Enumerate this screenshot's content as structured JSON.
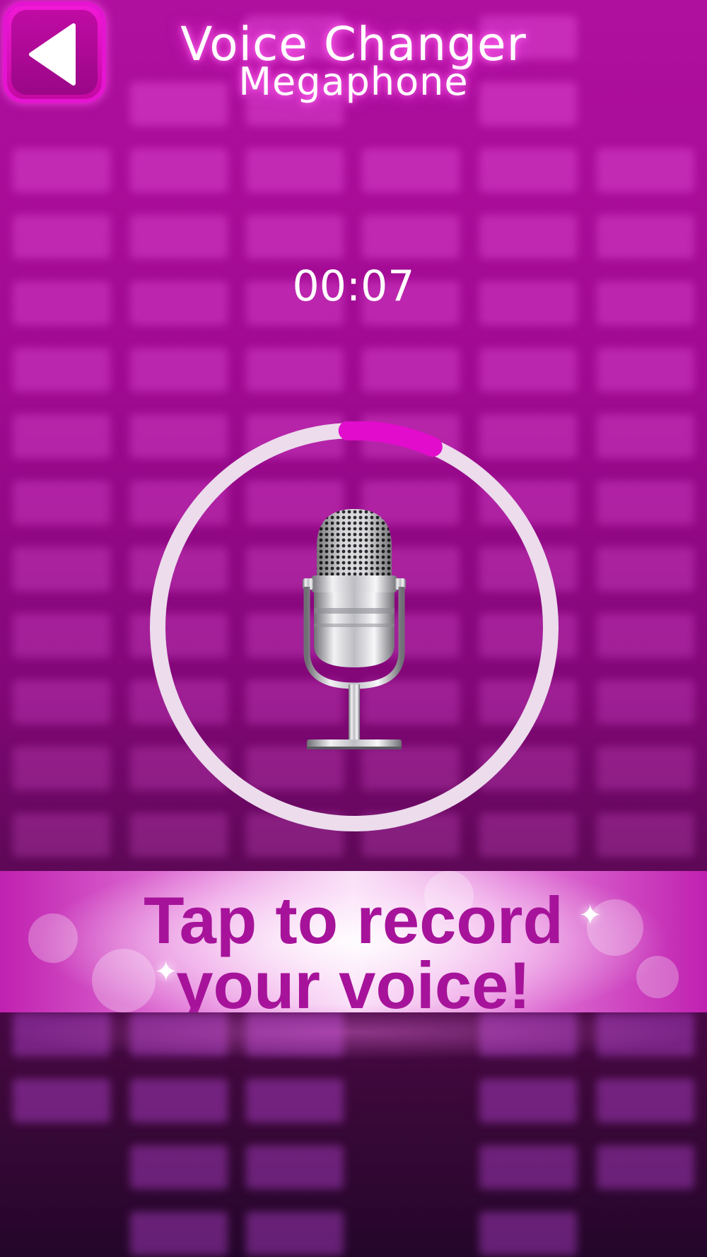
{
  "header": {
    "back_label": "",
    "title": "Voice Changer",
    "subtitle": "Megaphone"
  },
  "recorder": {
    "timer": "00:07",
    "progress": 0.07
  },
  "banner": {
    "line1": "Tap to record",
    "line2": "your voice!"
  },
  "icons": {
    "back": "back-arrow-icon",
    "microphone": "microphone-icon"
  },
  "colors": {
    "accent": "#e20ccc",
    "ring": "#ecdcec",
    "banner_text": "#a6139a"
  }
}
